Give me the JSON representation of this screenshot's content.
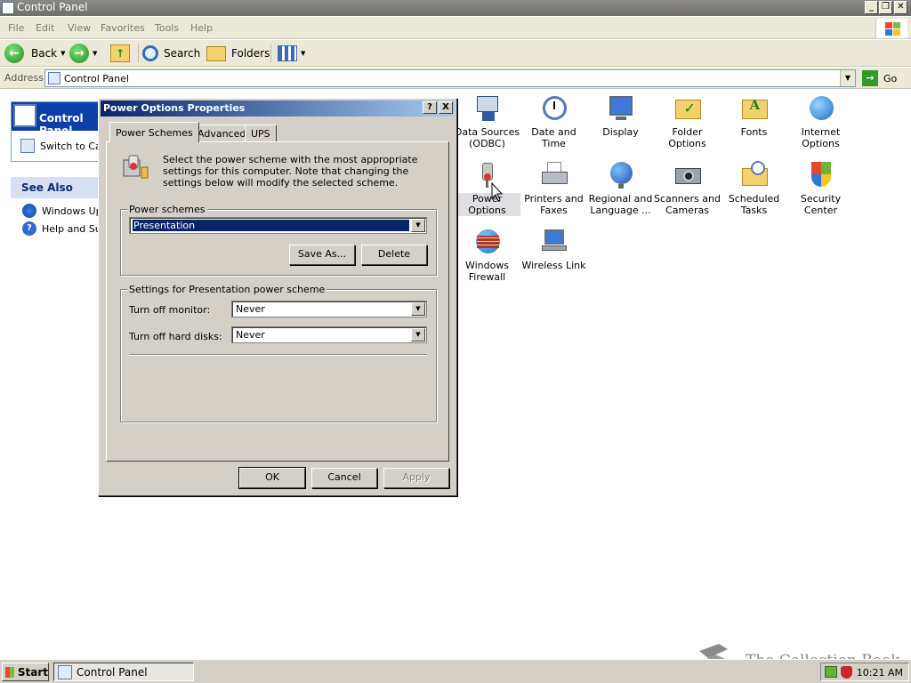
{
  "window": {
    "title": "Control Panel"
  },
  "menu": [
    "File",
    "Edit",
    "View",
    "Favorites",
    "Tools",
    "Help"
  ],
  "toolbar": {
    "back": "Back",
    "search": "Search",
    "folders": "Folders"
  },
  "address": {
    "label": "Address",
    "value": "Control Panel",
    "go": "Go"
  },
  "sidebar": {
    "panel_title": "Control Panel",
    "switch_link": "Switch to Cat",
    "see_also": "See Also",
    "items": [
      "Windows Upd",
      "Help and Sup"
    ]
  },
  "icons": [
    {
      "label": "Data Sources (ODBC)",
      "icon": "odbc-icon"
    },
    {
      "label": "Date and Time",
      "icon": "clock-icon"
    },
    {
      "label": "Display",
      "icon": "display-icon"
    },
    {
      "label": "Folder Options",
      "icon": "folder-options-icon"
    },
    {
      "label": "Fonts",
      "icon": "fonts-icon"
    },
    {
      "label": "Internet Options",
      "icon": "globe-icon"
    },
    {
      "label": "Power Options",
      "icon": "power-icon",
      "selected": true
    },
    {
      "label": "Printers and Faxes",
      "icon": "printer-icon"
    },
    {
      "label": "Regional and Language ...",
      "icon": "globe-icon"
    },
    {
      "label": "Scanners and Cameras",
      "icon": "camera-icon"
    },
    {
      "label": "Scheduled Tasks",
      "icon": "tasks-icon"
    },
    {
      "label": "Security Center",
      "icon": "shield-icon"
    },
    {
      "label": "Windows Firewall",
      "icon": "firewall-icon"
    },
    {
      "label": "Wireless Link",
      "icon": "wireless-icon"
    }
  ],
  "dialog": {
    "title": "Power Options Properties",
    "help_btn": "?",
    "close_btn": "X",
    "tabs": [
      "Power Schemes",
      "Advanced",
      "UPS"
    ],
    "intro": "Select the power scheme with the most appropriate settings for this computer. Note that changing the settings below will modify the selected scheme.",
    "schemes_group": "Power schemes",
    "scheme_value": "Presentation",
    "save_as": "Save As...",
    "delete": "Delete",
    "settings_group": "Settings for Presentation power scheme",
    "monitor_label": "Turn off monitor:",
    "monitor_value": "Never",
    "disks_label": "Turn off hard disks:",
    "disks_value": "Never",
    "ok": "OK",
    "cancel": "Cancel",
    "apply": "Apply"
  },
  "taskbar": {
    "start": "Start",
    "task": "Control Panel",
    "clock": "10:21 AM",
    "watermark": "The Collection Book"
  },
  "colors": {
    "dialog_title": "#0a246a",
    "selection": "#0a246a",
    "panel_head": "#0b3fa8"
  }
}
